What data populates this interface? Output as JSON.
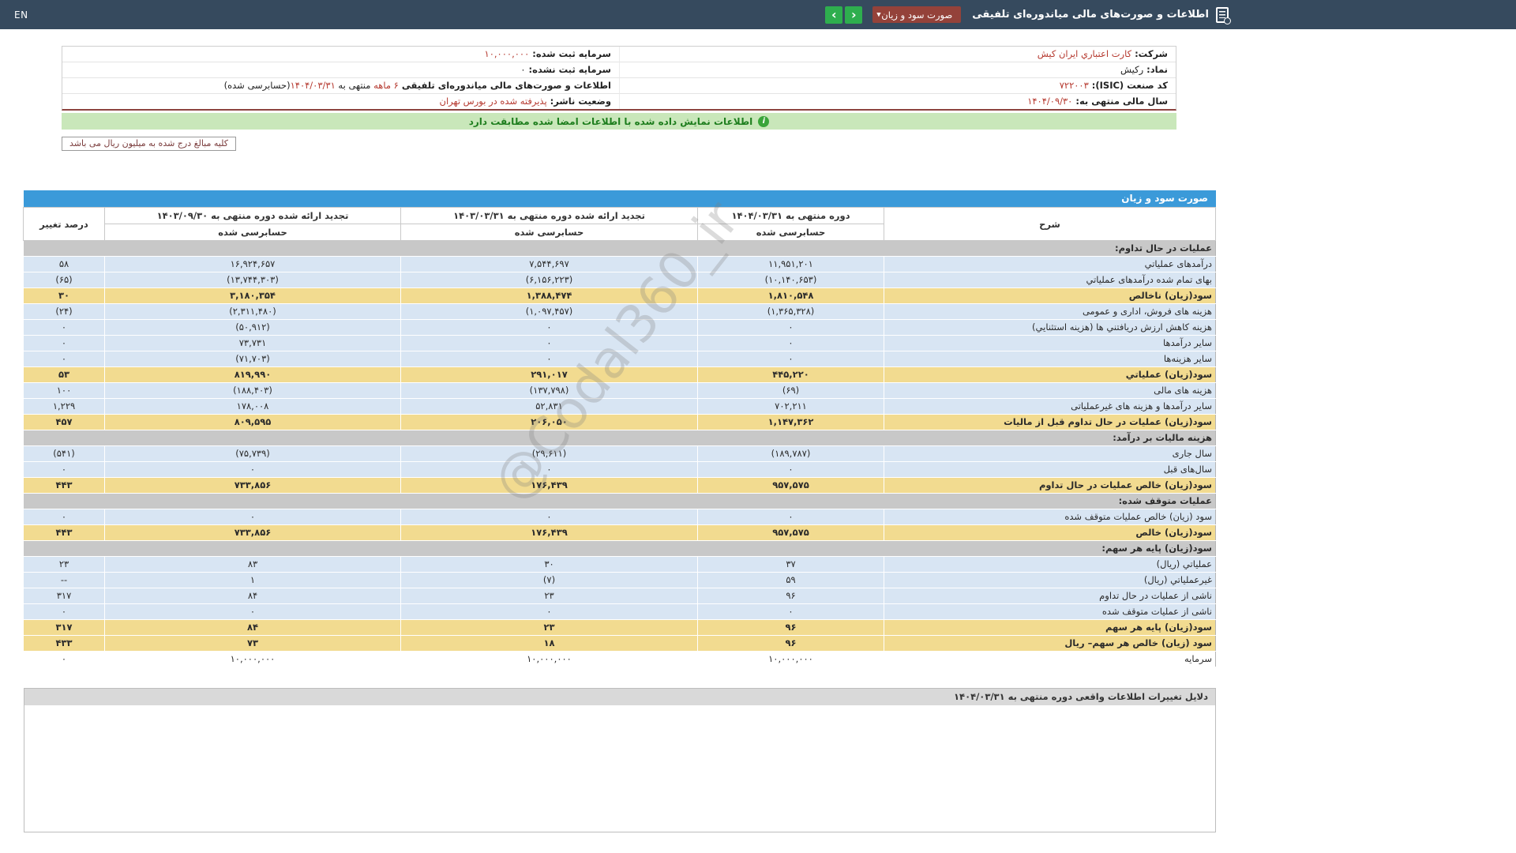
{
  "colors": {
    "navbar": "#364a5e",
    "accent-green": "#2eae4e",
    "select-red": "#94423a",
    "table-blue": "#3b9ad9",
    "row-blue": "#d8e5f3",
    "row-yellow": "#f2db90",
    "row-gray": "#c8c8c8",
    "neg-red": "#cc2222",
    "info-red": "#b5382e",
    "sig-green-bg": "#c9e7ba",
    "sig-green-text": "#1e7e1e"
  },
  "navbar": {
    "title": "اطلاعات و صورت‌های مالی میاندوره‌ای تلفیقی",
    "statement_select": {
      "value": "صورت سود و زیان"
    },
    "lang_label": "EN"
  },
  "company_info": {
    "right_rows": [
      {
        "label": "شرکت:",
        "parts": [
          {
            "t": "کارت اعتباري ایران کیش",
            "red": true
          }
        ]
      },
      {
        "label": "نماد:",
        "parts": [
          {
            "t": "رکیش",
            "red": false
          }
        ]
      },
      {
        "label": "کد صنعت (ISIC):",
        "parts": [
          {
            "t": "۷۲۲۰۰۳",
            "red": true
          }
        ]
      },
      {
        "label": "سال مالی منتهی به:",
        "parts": [
          {
            "t": "۱۴۰۴/۰۹/۳۰",
            "red": true
          }
        ]
      }
    ],
    "left_rows": [
      {
        "label": "سرمایه ثبت شده:",
        "parts": [
          {
            "t": "۱۰,۰۰۰,۰۰۰",
            "red": true
          }
        ]
      },
      {
        "label": "سرمایه ثبت نشده:",
        "parts": [
          {
            "t": "۰",
            "red": false
          }
        ]
      },
      {
        "label": "اطلاعات و صورت‌های مالی میاندوره‌ای تلفیقی",
        "parts": [
          {
            "t": "۶ ماهه",
            "red": true
          },
          {
            "t": " منتهی به ",
            "red": false
          },
          {
            "t": "۱۴۰۴/۰۳/۳۱",
            "red": true
          },
          {
            "t": "(حسابرسی شده)",
            "red": false
          }
        ]
      },
      {
        "label": "وضعیت ناشر:",
        "parts": [
          {
            "t": "پذیرفته شده در بورس تهران",
            "red": true
          }
        ]
      }
    ]
  },
  "signature_bar": {
    "text": "اطلاعات نمایش داده شده با اطلاعات امضا شده مطابقت دارد"
  },
  "unit_note": {
    "text": "کلیه مبالغ درج شده به میلیون ریال می باشد"
  },
  "income_table": {
    "title": "صورت سود و زیان",
    "columns": {
      "desc": "شرح",
      "period_current": "دوره منتهی به ۱۴۰۴/۰۳/۳۱",
      "period_restated_q": "تجدید ارائه شده دوره منتهی به ۱۴۰۳/۰۳/۳۱",
      "period_restated_y": "تجدید ارائه شده دوره منتهی به ۱۴۰۳/۰۹/۳۰",
      "audited": "حسابرسی شده",
      "pct_change": "درصد تغییر"
    },
    "rows": [
      {
        "type": "section",
        "label": "عملیات در حال تداوم:"
      },
      {
        "type": "data",
        "label": "درآمدهای عملیاتي",
        "values": [
          "۱۱,۹۵۱,۲۰۱",
          "۷,۵۴۴,۶۹۷",
          "۱۶,۹۲۴,۶۵۷"
        ],
        "pct": "۵۸"
      },
      {
        "type": "data",
        "label": "بهای تمام شده درآمدهای عملیاتي",
        "values": [
          "(۱۰,۱۴۰,۶۵۳)",
          "(۶,۱۵۶,۲۲۳)",
          "(۱۳,۷۴۴,۳۰۳)"
        ],
        "pct": "(۶۵)"
      },
      {
        "type": "summary",
        "label": "سود(زیان) ناخالص",
        "values": [
          "۱,۸۱۰,۵۴۸",
          "۱,۳۸۸,۴۷۴",
          "۳,۱۸۰,۳۵۴"
        ],
        "pct": "۳۰"
      },
      {
        "type": "data",
        "label": "هزینه های فروش، اداری و عمومی",
        "values": [
          "(۱,۳۶۵,۳۲۸)",
          "(۱,۰۹۷,۴۵۷)",
          "(۲,۳۱۱,۴۸۰)"
        ],
        "pct": "(۲۴)"
      },
      {
        "type": "data",
        "label": "هزینه کاهش ارزش دریافتني ها (هزینه استثنایي)",
        "values": [
          "۰",
          "۰",
          "(۵۰,۹۱۲)"
        ],
        "pct": "۰"
      },
      {
        "type": "data",
        "label": "سایر درآمدها",
        "values": [
          "۰",
          "۰",
          "۷۳,۷۳۱"
        ],
        "pct": "۰"
      },
      {
        "type": "data",
        "label": "سایر هزینه‌ها",
        "values": [
          "۰",
          "۰",
          "(۷۱,۷۰۳)"
        ],
        "pct": "۰"
      },
      {
        "type": "summary",
        "label": "سود(زیان) عملیاتي",
        "values": [
          "۴۴۵,۲۲۰",
          "۲۹۱,۰۱۷",
          "۸۱۹,۹۹۰"
        ],
        "pct": "۵۳"
      },
      {
        "type": "data",
        "label": "هزینه های مالی",
        "values": [
          "(۶۹)",
          "(۱۳۷,۷۹۸)",
          "(۱۸۸,۴۰۳)"
        ],
        "pct": "۱۰۰"
      },
      {
        "type": "data",
        "label": "سایر درآمدها و هزینه های غیرعملیاتی",
        "values": [
          "۷۰۲,۲۱۱",
          "۵۲,۸۳۱",
          "۱۷۸,۰۰۸"
        ],
        "pct": "۱,۲۲۹"
      },
      {
        "type": "summary",
        "label": "سود(زیان) عملیات در حال تداوم قبل از مالیات",
        "values": [
          "۱,۱۴۷,۳۶۲",
          "۲۰۶,۰۵۰",
          "۸۰۹,۵۹۵"
        ],
        "pct": "۴۵۷"
      },
      {
        "type": "section",
        "label": "هزینه مالیات بر درآمد:"
      },
      {
        "type": "data",
        "label": "سال جاری",
        "values": [
          "(۱۸۹,۷۸۷)",
          "(۲۹,۶۱۱)",
          "(۷۵,۷۳۹)"
        ],
        "pct": "(۵۴۱)"
      },
      {
        "type": "data",
        "label": "سال‌های قبل",
        "values": [
          "۰",
          "۰",
          "۰"
        ],
        "pct": "۰"
      },
      {
        "type": "summary",
        "label": "سود(زیان) خالص عملیات در حال تداوم",
        "values": [
          "۹۵۷,۵۷۵",
          "۱۷۶,۴۳۹",
          "۷۳۳,۸۵۶"
        ],
        "pct": "۴۴۳"
      },
      {
        "type": "section",
        "label": "عملیات متوقف شده:"
      },
      {
        "type": "data",
        "label": "سود (زیان) خالص عملیات متوقف شده",
        "values": [
          "۰",
          "۰",
          "۰"
        ],
        "pct": "۰"
      },
      {
        "type": "summary",
        "label": "سود(زیان) خالص",
        "values": [
          "۹۵۷,۵۷۵",
          "۱۷۶,۴۳۹",
          "۷۳۳,۸۵۶"
        ],
        "pct": "۴۴۳"
      },
      {
        "type": "section",
        "label": "سود(زیان) پایه هر سهم:"
      },
      {
        "type": "data",
        "label": "عملیاتي (ریال)",
        "values": [
          "۳۷",
          "۳۰",
          "۸۳"
        ],
        "pct": "۲۳"
      },
      {
        "type": "data",
        "label": "غیرعملیاتي (ریال)",
        "values": [
          "۵۹",
          "(۷)",
          "۱"
        ],
        "pct": "--"
      },
      {
        "type": "data",
        "label": "ناشی از عملیات در حال تداوم",
        "values": [
          "۹۶",
          "۲۳",
          "۸۴"
        ],
        "pct": "۳۱۷"
      },
      {
        "type": "data",
        "label": "ناشی از عملیات متوقف شده",
        "values": [
          "۰",
          "۰",
          "۰"
        ],
        "pct": "۰"
      },
      {
        "type": "summary",
        "label": "سود(زیان) پایه هر سهم",
        "values": [
          "۹۶",
          "۲۳",
          "۸۴"
        ],
        "pct": "۳۱۷"
      },
      {
        "type": "summary",
        "label": "سود (زیان) خالص هر سهم– ریال",
        "values": [
          "۹۶",
          "۱۸",
          "۷۳"
        ],
        "pct": "۴۳۳"
      },
      {
        "type": "plain",
        "label": "سرمایه",
        "values": [
          "۱۰,۰۰۰,۰۰۰",
          "۱۰,۰۰۰,۰۰۰",
          "۱۰,۰۰۰,۰۰۰"
        ],
        "pct": "۰"
      }
    ]
  },
  "watermark": {
    "text": "@Codal360_ir"
  },
  "footer_box": {
    "title": "دلایل تغییرات اطلاعات واقعی دوره منتهی به ۱۴۰۴/۰۳/۳۱"
  }
}
